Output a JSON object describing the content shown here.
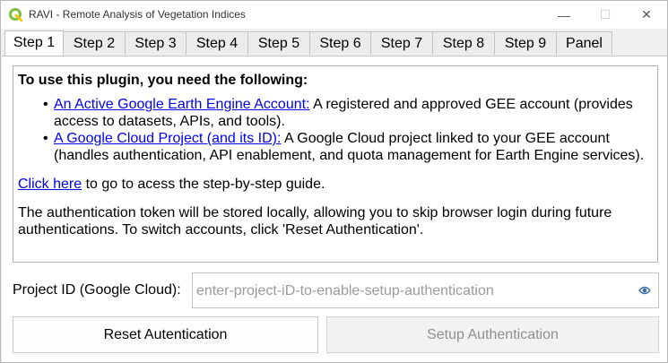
{
  "window": {
    "title": "RAVI - Remote Analysis of Vegetation Indices",
    "minimize_glyph": "—",
    "maximize_glyph": "☐",
    "close_glyph": "✕",
    "icon": "qgis-logo-icon",
    "accent_color": "#7fbf3f"
  },
  "tabs": [
    {
      "label": "Step 1",
      "active": true
    },
    {
      "label": "Step 2",
      "active": false
    },
    {
      "label": "Step 3",
      "active": false
    },
    {
      "label": "Step 4",
      "active": false
    },
    {
      "label": "Step 5",
      "active": false
    },
    {
      "label": "Step 6",
      "active": false
    },
    {
      "label": "Step 7",
      "active": false
    },
    {
      "label": "Step 8",
      "active": false
    },
    {
      "label": "Step 9",
      "active": false
    },
    {
      "label": "Panel",
      "active": false
    }
  ],
  "info": {
    "heading": "To use this plugin, you need the following:",
    "requirements": [
      {
        "link_text": "An Active Google Earth Engine Account:",
        "description": " A registered and approved GEE account (provides access to datasets, APIs, and tools)."
      },
      {
        "link_text": "A Google Cloud Project (and its ID):",
        "description": " A Google Cloud project linked to your GEE account (handles authentication, API enablement, and quota management for Earth Engine services)."
      }
    ],
    "guide_link": "Click here",
    "guide_text": " to go to acess the step-by-step guide.",
    "token_note": "The authentication token will be stored locally, allowing you to skip browser login during future authentications. To switch accounts, click 'Reset Authentication'.",
    "link_color": "#0000ee"
  },
  "project": {
    "label": "Project ID (Google Cloud):",
    "placeholder": "enter-project-iD-to-enable-setup-authentication",
    "value": "",
    "toggle_icon": "eye-icon"
  },
  "buttons": {
    "reset_label": "Reset Autentication",
    "setup_label": "Setup Authentication",
    "setup_enabled": false
  }
}
